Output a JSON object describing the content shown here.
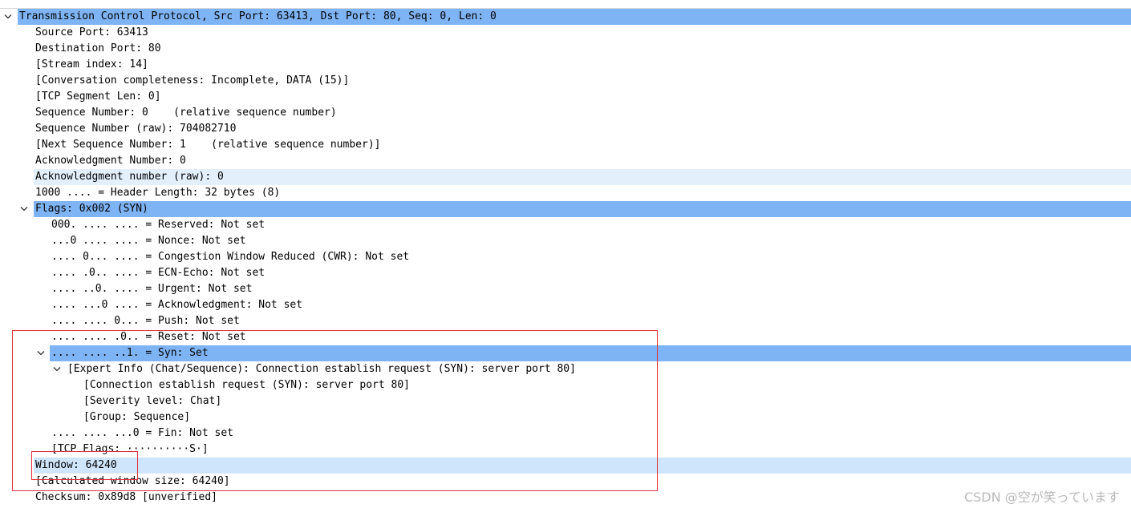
{
  "tcp": {
    "header": "Transmission Control Protocol, Src Port: 63413, Dst Port: 80, Seq: 0, Len: 0",
    "source_port": "Source Port: 63413",
    "dest_port": "Destination Port: 80",
    "stream_index": "[Stream index: 14]",
    "conversation": "[Conversation completeness: Incomplete, DATA (15)]",
    "segment_len": "[TCP Segment Len: 0]",
    "seq": "Sequence Number: 0    (relative sequence number)",
    "seq_raw": "Sequence Number (raw): 704082710",
    "next_seq": "[Next Sequence Number: 1    (relative sequence number)]",
    "ack": "Acknowledgment Number: 0",
    "ack_raw": "Acknowledgment number (raw): 0",
    "header_len": "1000 .... = Header Length: 32 bytes (8)",
    "flags": {
      "header": "Flags: 0x002 (SYN)",
      "reserved": "000. .... .... = Reserved: Not set",
      "nonce": "...0 .... .... = Nonce: Not set",
      "cwr": ".... 0... .... = Congestion Window Reduced (CWR): Not set",
      "ecn": ".... .0.. .... = ECN-Echo: Not set",
      "urgent": ".... ..0. .... = Urgent: Not set",
      "ack_flag": ".... ...0 .... = Acknowledgment: Not set",
      "push": ".... .... 0... = Push: Not set",
      "reset": ".... .... .0.. = Reset: Not set",
      "syn": ".... .... ..1. = Syn: Set",
      "expert": "[Expert Info (Chat/Sequence): Connection establish request (SYN): server port 80]",
      "expert_msg": "[Connection establish request (SYN): server port 80]",
      "severity": "[Severity level: Chat]",
      "group": "[Group: Sequence]",
      "fin": ".... .... ...0 = Fin: Not set",
      "tcp_flags": "[TCP Flags: ··········S·]"
    },
    "window": "Window: 64240",
    "calc_window": "[Calculated window size: 64240]",
    "checksum": "Checksum: 0x89d8 [unverified]"
  },
  "watermark": "CSDN @空が笑っています",
  "colors": {
    "selected": "#7fb4f4",
    "hover": "#e3f0fc",
    "hover_strong": "#cfe5fb",
    "annotation": "#e0323c"
  }
}
